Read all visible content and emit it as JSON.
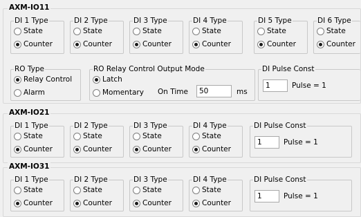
{
  "axm_io11": {
    "title": "AXM-IO11",
    "di_groups": [
      {
        "label": "DI 1 Type"
      },
      {
        "label": "DI 2 Type"
      },
      {
        "label": "DI 3 Type"
      },
      {
        "label": "DI 4 Type"
      },
      {
        "label": "DI 5 Type"
      },
      {
        "label": "DI 6 Type"
      }
    ],
    "state_label": "State",
    "counter_label": "Counter",
    "ro_type": {
      "label": "RO Type",
      "opt1": "Relay Control",
      "opt2": "Alarm"
    },
    "ro_mode": {
      "label": "RO Relay Control Output Mode",
      "opt1": "Latch",
      "opt2": "Momentary",
      "on_time_label": "On Time",
      "on_time_value": "50",
      "unit": "ms"
    },
    "pulse": {
      "label": "DI Pulse Const",
      "value": "1",
      "suffix": "Pulse = 1"
    }
  },
  "axm_io21": {
    "title": "AXM-IO21",
    "di_groups": [
      {
        "label": "DI 1 Type"
      },
      {
        "label": "DI 2 Type"
      },
      {
        "label": "DI 3 Type"
      },
      {
        "label": "DI 4 Type"
      }
    ],
    "state_label": "State",
    "counter_label": "Counter",
    "pulse": {
      "label": "DI Pulse Const",
      "value": "1",
      "suffix": "Pulse = 1"
    }
  },
  "axm_io31": {
    "title": "AXM-IO31",
    "di_groups": [
      {
        "label": "DI 1 Type"
      },
      {
        "label": "DI 2 Type"
      },
      {
        "label": "DI 3 Type"
      },
      {
        "label": "DI 4 Type"
      }
    ],
    "state_label": "State",
    "counter_label": "Counter",
    "pulse": {
      "label": "DI Pulse Const",
      "value": "1",
      "suffix": "Pulse = 1"
    }
  }
}
